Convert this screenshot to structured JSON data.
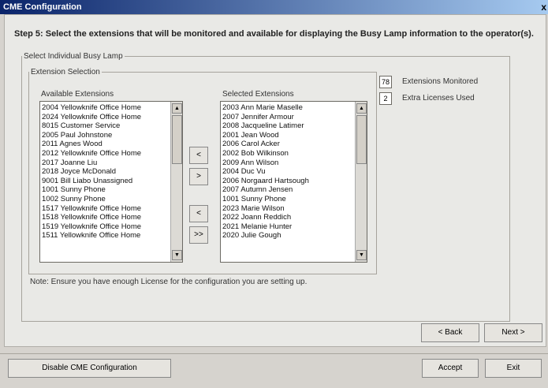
{
  "window": {
    "title": "CME Configuration",
    "close_glyph": "x"
  },
  "step": {
    "text": "Step 5: Select the extensions that will be monitored and available for displaying the Busy Lamp information to the operator(s)."
  },
  "groups": {
    "outer_legend": "Select Individual Busy Lamp",
    "inner_legend": "Extension Selection"
  },
  "available": {
    "label": "Available Extensions",
    "items": [
      "2004 Yellowknife Office Home",
      "2024 Yellowknife Office Home",
      "8015 Customer Service",
      "2005 Paul Johnstone",
      "2011 Agnes Wood",
      "2012 Yellowknife Office Home",
      "2017 Joanne Liu",
      "2018 Joyce McDonald",
      "9001 Bill Liabo Unassigned",
      "1001 Sunny Phone",
      "1002 Sunny Phone",
      "1517 Yellowknife Office Home",
      "1518 Yellowknife Office Home",
      "1519 Yellowknife Office Home",
      "1511 Yellowknife Office Home"
    ]
  },
  "selected": {
    "label": "Selected Extensions",
    "items": [
      "2003 Ann Marie Maselle",
      "2007 Jennifer Armour",
      "2008 Jacqueline Latimer",
      "2001 Jean Wood",
      "2006 Carol Acker",
      "2002 Bob Wilkinson",
      "2009 Ann Wilson",
      "2004 Duc Vu",
      "2006 Norgaard Hartsough",
      "2007 Autumn Jensen",
      "1001 Sunny Phone",
      "2023 Marie Wilson",
      "2022 Joann Reddich",
      "2021 Melanie Hunter",
      "2020 Julie Gough"
    ]
  },
  "move_buttons": {
    "add": "<",
    "add_all": ">",
    "remove": "<",
    "remove_all": ">>"
  },
  "stats": {
    "monitored_value": "78",
    "monitored_label": "Extensions Monitored",
    "licenses_value": "2",
    "licenses_label": "Extra Licenses Used"
  },
  "note": "Note: Ensure you have enough License for the configuration you are setting up.",
  "nav": {
    "back": "< Back",
    "next": "Next >"
  },
  "footer": {
    "disable": "Disable CME Configuration",
    "accept": "Accept",
    "exit": "Exit"
  },
  "icons": {
    "scroll_up": "up-arrow-icon",
    "scroll_down": "down-arrow-icon"
  }
}
